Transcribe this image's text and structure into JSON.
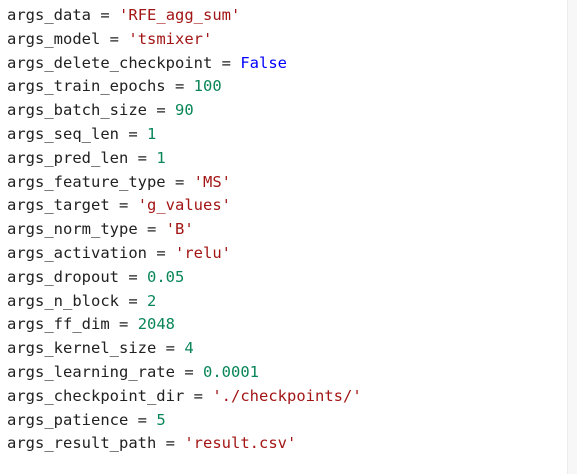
{
  "colors": {
    "background": "#ffffff",
    "text": "#212121",
    "string": "#a31515",
    "number": "#098658",
    "keyword": "#0000ff"
  },
  "code": {
    "operator": "=",
    "lines": [
      {
        "name": "args_data",
        "value": "'RFE_agg_sum'",
        "type": "str"
      },
      {
        "name": "args_model",
        "value": "'tsmixer'",
        "type": "str"
      },
      {
        "name": "args_delete_checkpoint",
        "value": "False",
        "type": "kw"
      },
      {
        "name": "args_train_epochs",
        "value": "100",
        "type": "num"
      },
      {
        "name": "args_batch_size",
        "value": "90",
        "type": "num"
      },
      {
        "name": "args_seq_len",
        "value": "1",
        "type": "num"
      },
      {
        "name": "args_pred_len",
        "value": "1",
        "type": "num"
      },
      {
        "name": "args_feature_type",
        "value": "'MS'",
        "type": "str"
      },
      {
        "name": "args_target",
        "value": "'g_values'",
        "type": "str"
      },
      {
        "name": "args_norm_type",
        "value": "'B'",
        "type": "str"
      },
      {
        "name": "args_activation",
        "value": "'relu'",
        "type": "str"
      },
      {
        "name": "args_dropout",
        "value": "0.05",
        "type": "num"
      },
      {
        "name": "args_n_block",
        "value": "2",
        "type": "num"
      },
      {
        "name": "args_ff_dim",
        "value": "2048",
        "type": "num"
      },
      {
        "name": "args_kernel_size",
        "value": "4",
        "type": "num"
      },
      {
        "name": "args_learning_rate",
        "value": "0.0001",
        "type": "num"
      },
      {
        "name": "args_checkpoint_dir",
        "value": "'./checkpoints/'",
        "type": "str"
      },
      {
        "name": "args_patience",
        "value": "5",
        "type": "num"
      },
      {
        "name": "args_result_path",
        "value": "'result.csv'",
        "type": "str"
      }
    ]
  }
}
